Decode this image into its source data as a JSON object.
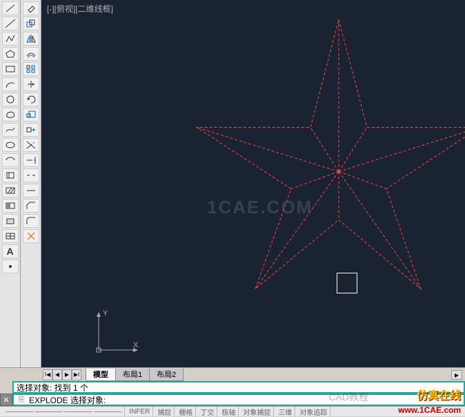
{
  "viewport_label": "[-][俯视][二维线框]",
  "toolbars": {
    "left1": [
      "╱",
      "╱",
      "▭",
      "○",
      "⬠",
      "⌒",
      "～",
      "☁",
      "⟋",
      "⊙",
      "▢",
      "⊡",
      "◫",
      "A",
      "◯"
    ],
    "left2": [
      "N",
      "✎",
      "⊥",
      "△",
      "⬡",
      "⌂",
      "▤",
      "◐",
      "▣",
      "◫",
      "▭",
      "⊞",
      "◨",
      "◧",
      "◩",
      "◪",
      "◧",
      "⟐",
      "⫽",
      "◫",
      "◨",
      "◩"
    ]
  },
  "watermark": "1CAE.COM",
  "ucs": {
    "x": "X",
    "y": "Y"
  },
  "tabs": {
    "nav": [
      "I◀",
      "◀",
      "▶",
      "▶I"
    ],
    "items": [
      "模型",
      "布局1",
      "布局2"
    ],
    "active_index": 0,
    "scroll_right": "▸"
  },
  "close_btn": "✕",
  "command_lines": {
    "line1": "选择对象: 找到 1 个",
    "line2_icon": "⎘",
    "line2_prompt": "EXPLODE 选择对象:"
  },
  "status": {
    "coords": "———— ———— ———— ————",
    "segments": [
      "INFER",
      "捕捉",
      "栅格",
      "丁交",
      "极轴",
      "对象捕捉",
      "三维",
      "对象追踪"
    ]
  },
  "watermarks_overlay": {
    "cad_text": "CAD教程",
    "brand": "仿真在线",
    "url": "www.1CAE.com"
  }
}
